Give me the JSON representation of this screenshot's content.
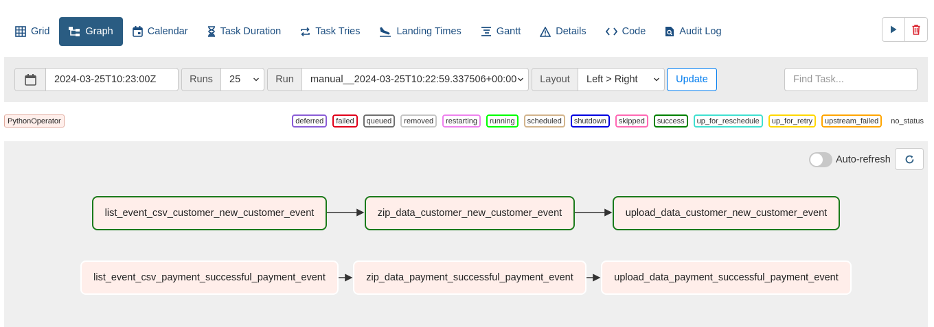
{
  "tabs": [
    {
      "label": "Grid",
      "icon": "grid-icon"
    },
    {
      "label": "Graph",
      "icon": "graph-icon",
      "active": true
    },
    {
      "label": "Calendar",
      "icon": "calendar-icon"
    },
    {
      "label": "Task Duration",
      "icon": "hourglass-icon"
    },
    {
      "label": "Task Tries",
      "icon": "retry-icon"
    },
    {
      "label": "Landing Times",
      "icon": "plane-landing-icon"
    },
    {
      "label": "Gantt",
      "icon": "gantt-icon"
    },
    {
      "label": "Details",
      "icon": "warning-triangle-icon"
    },
    {
      "label": "Code",
      "icon": "code-icon"
    },
    {
      "label": "Audit Log",
      "icon": "audit-log-icon"
    }
  ],
  "controls": {
    "date_value": "2024-03-25T10:23:00Z",
    "runs_label": "Runs",
    "runs_value": "25",
    "run_label": "Run",
    "run_value": "manual__2024-03-25T10:22:59.337506+00:00",
    "layout_label": "Layout",
    "layout_value": "Left > Right",
    "update_label": "Update",
    "find_placeholder": "Find Task..."
  },
  "legend": {
    "operator": "PythonOperator",
    "states": [
      {
        "label": "deferred",
        "color": "#8a5cd6"
      },
      {
        "label": "failed",
        "color": "#e0001a"
      },
      {
        "label": "queued",
        "color": "#707070"
      },
      {
        "label": "removed",
        "color": "#c6c6c6"
      },
      {
        "label": "restarting",
        "color": "#ee82ee"
      },
      {
        "label": "running",
        "color": "#00ff00"
      },
      {
        "label": "scheduled",
        "color": "#d2b48c"
      },
      {
        "label": "shutdown",
        "color": "#0000e0"
      },
      {
        "label": "skipped",
        "color": "#ff69b4"
      },
      {
        "label": "success",
        "color": "#008000"
      },
      {
        "label": "up_for_reschedule",
        "color": "#40e0d0"
      },
      {
        "label": "up_for_retry",
        "color": "#ffd700"
      },
      {
        "label": "upstream_failed",
        "color": "#ffa500"
      },
      {
        "label": "no_status",
        "color": "none"
      }
    ]
  },
  "graph": {
    "auto_refresh_label": "Auto-refresh",
    "nodes": [
      {
        "label": "list_event_csv_customer_new_customer_event",
        "state": "success"
      },
      {
        "label": "zip_data_customer_new_customer_event",
        "state": "success"
      },
      {
        "label": "upload_data_customer_new_customer_event",
        "state": "success"
      },
      {
        "label": "list_event_csv_payment_successful_payment_event",
        "state": "no_status"
      },
      {
        "label": "zip_data_payment_successful_payment_event",
        "state": "no_status"
      },
      {
        "label": "upload_data_payment_successful_payment_event",
        "state": "no_status"
      }
    ]
  }
}
